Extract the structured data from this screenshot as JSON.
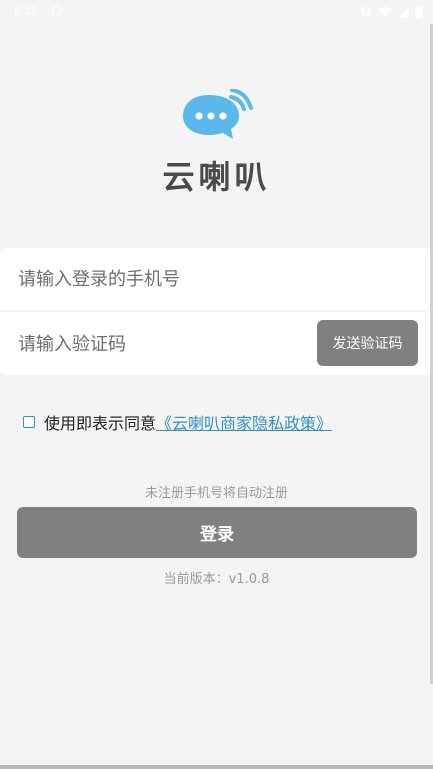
{
  "status_bar": {
    "time": "8:18",
    "icons": [
      "notification-icon",
      "mute-icon",
      "wifi-icon",
      "signal-icon",
      "battery-icon"
    ]
  },
  "app": {
    "name": "云喇叭",
    "logo_icon": "chat-bubble-icon",
    "logo_color": "#5bb8ea"
  },
  "form": {
    "phone_placeholder": "请输入登录的手机号",
    "phone_value": "",
    "code_placeholder": "请输入验证码",
    "code_value": "",
    "send_code_label": "发送验证码"
  },
  "agreement": {
    "checked": false,
    "text": "使用即表示同意",
    "policy_link": "《云喇叭商家隐私政策》"
  },
  "hint": "未注册手机号将自动注册",
  "login_label": "登录",
  "version": "当前版本：v1.0.8",
  "colors": {
    "button_bg": "#808080",
    "link": "#2f8fd0",
    "page_bg": "#f4f4f4"
  }
}
